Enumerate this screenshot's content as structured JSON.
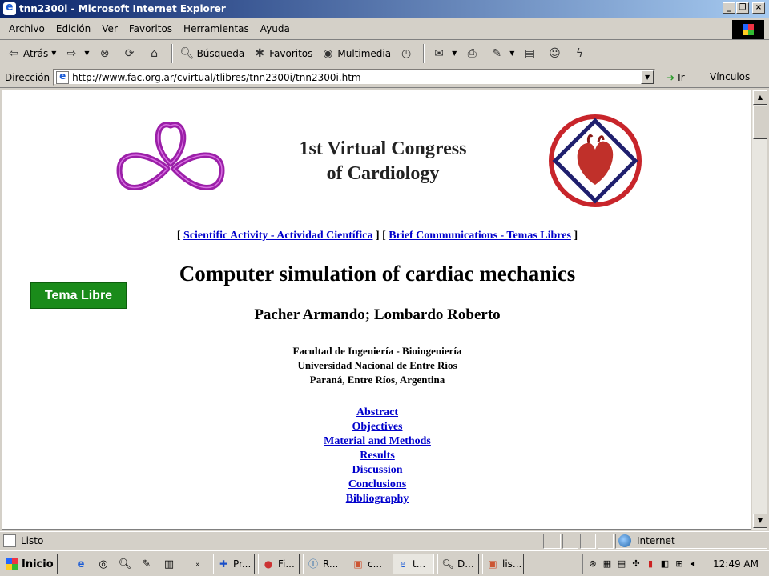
{
  "window": {
    "title": "tnn2300i - Microsoft Internet Explorer",
    "minimize": "_",
    "maximize": "❐",
    "close": "×"
  },
  "menu": [
    "Archivo",
    "Edición",
    "Ver",
    "Favoritos",
    "Herramientas",
    "Ayuda"
  ],
  "toolbar": {
    "back": "Atrás",
    "search": "Búsqueda",
    "favorites": "Favoritos",
    "multimedia": "Multimedia"
  },
  "address": {
    "label": "Dirección",
    "url": "http://www.fac.org.ar/cvirtual/tlibres/tnn2300i/tnn2300i.htm",
    "go": "Ir",
    "links": "Vínculos"
  },
  "page": {
    "congress_line1": "1st Virtual Congress",
    "congress_line2": "of Cardiology",
    "nav_open": "[ ",
    "nav_link1": "Scientific Activity - Actividad Científica",
    "nav_mid": " ] [ ",
    "nav_link2": "Brief Communications - Temas Libres",
    "nav_close": " ]",
    "title": "Computer simulation of cardiac mechanics",
    "authors": "Pacher Armando; Lombardo Roberto",
    "affiliation": [
      "Facultad de Ingeniería - Bioingeniería",
      "Universidad Nacional de Entre Ríos",
      "Paraná, Entre Ríos, Argentina"
    ],
    "toc": [
      "Abstract",
      "Objectives",
      "Material and Methods",
      "Results",
      "Discussion",
      "Conclusions",
      "Bibliography"
    ],
    "badge": "Tema Libre"
  },
  "status": {
    "text": "Listo",
    "zone": "Internet"
  },
  "taskbar": {
    "start": "Inicio",
    "tasks": [
      "Pr...",
      "Fi...",
      "R...",
      "c...",
      "t...",
      "D...",
      "lis..."
    ],
    "clock": "12:49 AM"
  },
  "colors": {
    "logo_purple": "#9b1fa8",
    "logo_ring": "#c8252b",
    "logo_diamond": "#1f1f6e",
    "heart": "#c0302a",
    "badge": "#1a8b1a",
    "link": "#0000cc"
  }
}
